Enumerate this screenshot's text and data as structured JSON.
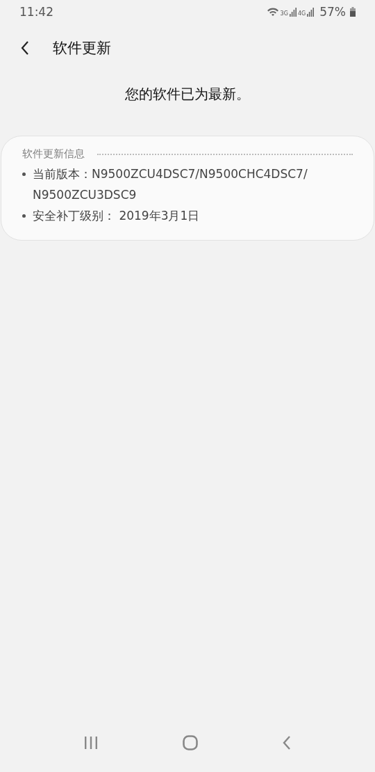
{
  "status_bar": {
    "time": "11:42",
    "networks": [
      "3G",
      "4G"
    ],
    "battery": "57%"
  },
  "header": {
    "title": "软件更新"
  },
  "message": "您的软件已为最新。",
  "info_card": {
    "heading": "软件更新信息",
    "items": [
      {
        "label": "当前版本：",
        "value": "N9500ZCU4DSC7/N9500CHC4DSC7/ N9500ZCU3DSC9"
      },
      {
        "label": "安全补丁级别：",
        "value": " 2019年3月1日"
      }
    ]
  }
}
